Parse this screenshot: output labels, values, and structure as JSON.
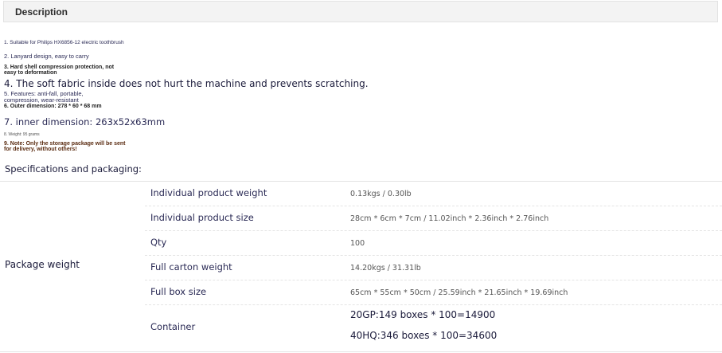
{
  "tab": {
    "label": "Description"
  },
  "description": [
    {
      "text": "1. Suitable for Philips HX6856-12 electric toothbrush",
      "style": "tiny"
    },
    {
      "text": "2. Lanyard design, easy to carry",
      "style": "small"
    },
    {
      "text": "3. Hard shell compression protection, not easy to deformation",
      "style": "bold"
    },
    {
      "text": "4. The soft fabric inside does not hurt the machine and prevents scratching.",
      "style": "large"
    },
    {
      "text": "5. Features: anti-fall, portable, compression, wear-resistant",
      "style": "small"
    },
    {
      "text": "6. Outer dimension: 278 * 60 * 68 mm",
      "style": "bold"
    },
    {
      "text": "7. inner dimension: 263x52x63mm",
      "style": "mid"
    },
    {
      "text": "8. Weight: 95 grams",
      "style": "4px"
    },
    {
      "text": "9. Note: Only the storage package will be sent for delivery, without others!",
      "style": "brown"
    }
  ],
  "specs": {
    "title": "Specifications and packaging:",
    "group_label": "Package weight",
    "rows": [
      {
        "label": "Individual product weight",
        "value": "0.13kgs / 0.30lb"
      },
      {
        "label": "Individual product size",
        "value": "28cm * 6cm * 7cm / 11.02inch * 2.36inch * 2.76inch"
      },
      {
        "label": "Qty",
        "value": "100"
      },
      {
        "label": "Full carton weight",
        "value": "14.20kgs / 31.31lb"
      },
      {
        "label": "Full box size",
        "value": "65cm * 55cm * 50cm / 25.59inch * 21.65inch * 19.69inch"
      },
      {
        "label": "Container",
        "value": "20GP:149 boxes * 100=14900",
        "value2": "40HQ:346 boxes * 100=34600"
      }
    ]
  }
}
